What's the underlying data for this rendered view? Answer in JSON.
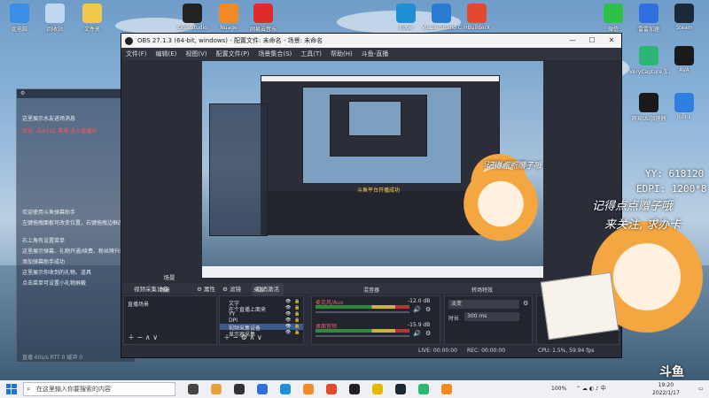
{
  "desktop_icons_top": [
    {
      "label": "此电脑",
      "icon": "computer-icon",
      "color": "#3a8ee6"
    },
    {
      "label": "回收站",
      "icon": "recycle-bin-icon",
      "color": "#bfd8f0"
    },
    {
      "label": "文件夹",
      "icon": "folder-icon",
      "color": "#f2c94c"
    },
    {
      "label": "OBS Studio",
      "icon": "obs-icon",
      "color": "#222222"
    },
    {
      "label": "Nuage",
      "icon": "app-icon",
      "color": "#f08a24"
    },
    {
      "label": "网易云音乐",
      "icon": "netease-music-icon",
      "color": "#e02b2b"
    },
    {
      "label": "Edge",
      "icon": "edge-icon",
      "color": "#1f8fd6"
    },
    {
      "label": "Visual Studio Code",
      "icon": "vscode-icon",
      "color": "#2a7cd3"
    },
    {
      "label": "HBuilderX",
      "icon": "hbuilder-icon",
      "color": "#e2492f"
    },
    {
      "label": "微信",
      "icon": "wechat-icon",
      "color": "#2ec14a"
    },
    {
      "label": "雷雷加速",
      "icon": "booster-icon",
      "color": "#2f6fe0"
    },
    {
      "label": "Steam",
      "icon": "steam-icon",
      "color": "#1b2838"
    }
  ],
  "desktop_icons_right": [
    {
      "label": "VeryCapture 加速器",
      "icon": "verycapture-icon",
      "color": "#2bb673"
    },
    {
      "label": "AVA",
      "icon": "ava-icon",
      "color": "#1a1a1a"
    },
    {
      "label": "网易UU加速器",
      "icon": "uu-booster-icon",
      "color": "#1a1a1a"
    },
    {
      "label": "Jolink",
      "icon": "jolink-icon",
      "color": "#2f7fe0"
    }
  ],
  "chat_panel": {
    "lines": [
      {
        "text": "这里展示水友进场消息",
        "hl": false
      },
      {
        "text": "欢迎 【LV12】某某 进入直播间",
        "hl": true
      },
      {
        "text": "欢迎使用斗鱼弹幕助手",
        "hl": false
      },
      {
        "text": "左键拖拽面板可改变位置，右键拖拽边框改变大小",
        "hl": false
      },
      {
        "text": "右上角有设置菜单",
        "hl": false
      },
      {
        "text": "这里展示弹幕、礼物开通/续费、粉丝牌升级等",
        "hl": false
      },
      {
        "text": "添加弹幕助手成功",
        "hl": false
      },
      {
        "text": "这里展示你收到的礼物、道具",
        "hl": false
      },
      {
        "text": "点击菜单可设置小礼物屏蔽",
        "hl": false
      }
    ],
    "footer": "直播 60s/s RTT 0 缓冲 0"
  },
  "obs": {
    "title": "OBS 27.1.3 (64-bit, windows) - 配置文件: 未命名 - 场景: 未命名",
    "menu": [
      "文件(F)",
      "编辑(E)",
      "视图(V)",
      "配置文件(P)",
      "场景集合(S)",
      "工具(T)",
      "帮助(H)",
      "斗鱼-直播"
    ],
    "toolbar": {
      "source_label": "视频采集设备",
      "properties": "属性",
      "filters": "滤镜",
      "deactivate": "取消激活"
    },
    "docks": {
      "scenes": {
        "title": "场景",
        "items": [
          "直播场景"
        ]
      },
      "sources": {
        "title": "来源",
        "items": [
          "文字",
          "在个直播上面来",
          "YY",
          "DPI",
          "视频采集设备",
          "显示器采集"
        ]
      },
      "mixer": {
        "title": "混音器",
        "channels": [
          {
            "name": "麦克风/Aux",
            "db": "-12.0 dB"
          },
          {
            "name": "桌面音频",
            "db": "-15.9 dB"
          }
        ]
      },
      "transitions": {
        "title": "转场特效",
        "type": "淡变",
        "duration_label": "时长",
        "duration": "300 ms"
      },
      "controls": {
        "title": "控件"
      }
    },
    "status": {
      "live": "LIVE: 00:00:00",
      "rec": "REC: 00:00:00",
      "cpu": "CPU: 1.5%, 59.94 fps"
    },
    "preview_notice": "斗鱼平台开播成功"
  },
  "overlay": {
    "yy": "YY: 618120",
    "dpi": "EDPI: 1200*8",
    "calligraphy_1": "记得点点赠子哦",
    "calligraphy_2": "来关注, 求办卡",
    "brand": "斗鱼"
  },
  "taskbar": {
    "search_placeholder": "在这里输入你要搜索的内容",
    "battery": "100%",
    "date": "2022/1/17",
    "time": "19:20"
  }
}
